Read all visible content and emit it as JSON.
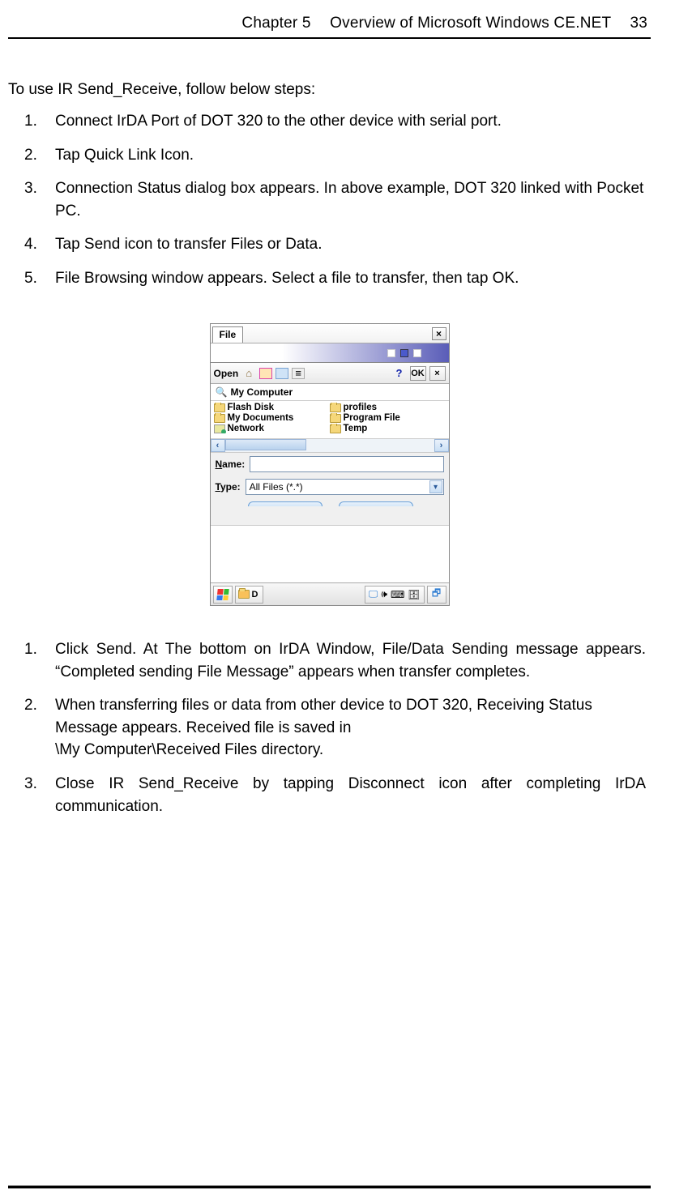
{
  "header": {
    "chapter": "Chapter 5",
    "title": "Overview of Microsoft Windows CE.NET",
    "page": "33"
  },
  "intro": "To use IR Send_Receive, follow below steps:",
  "steps_a": [
    "Connect IrDA Port of DOT 320 to the other device with serial port.",
    "Tap Quick Link Icon.",
    "Connection Status dialog box appears. In above example, DOT 320 linked with Pocket PC.",
    "Tap Send icon to transfer Files or Data.",
    "File Browsing window appears. Select a file to transfer, then tap OK."
  ],
  "figure": {
    "titlebar_tab": "File",
    "open_label": "Open",
    "ok_label": "OK",
    "crumb": "My Computer",
    "files_left": [
      "Flash Disk",
      "My Documents",
      "Network"
    ],
    "files_right": [
      "profiles",
      "Program File",
      "Temp"
    ],
    "name_label": "Name:",
    "name_ul": "N",
    "name_rest": "ame:",
    "name_value": "",
    "type_label": "Type:",
    "type_ul": "T",
    "type_rest": "ype:",
    "type_value": "All Files (*.*)",
    "task_label": "D"
  },
  "steps_b": [
    "Click Send. At The bottom on IrDA Window, File/Data Sending message appears. “Completed sending File Message” appears when transfer completes.",
    "When transferring files or data from other device to DOT 320, Receiving Status Message appears. Received file is saved in\n\\My Computer\\Received Files directory.",
    "Close IR Send_Receive by tapping Disconnect icon after completing IrDA communication."
  ]
}
